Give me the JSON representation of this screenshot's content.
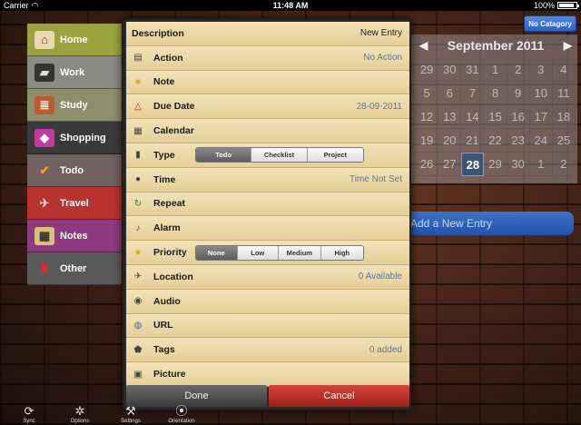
{
  "status_bar": {
    "carrier": "Carrier",
    "time": "11:48 AM",
    "battery": "100%"
  },
  "header": {
    "no_category_label": "No Catagory"
  },
  "calendar": {
    "month_year": "September 2011",
    "prev_arrow": "◀",
    "next_arrow": "▶",
    "days": [
      "29",
      "30",
      "31",
      "1",
      "2",
      "3",
      "4",
      "5",
      "6",
      "7",
      "8",
      "9",
      "10",
      "11",
      "12",
      "13",
      "14",
      "15",
      "16",
      "17",
      "18",
      "19",
      "20",
      "21",
      "22",
      "23",
      "24",
      "25",
      "26",
      "27",
      "28",
      "29",
      "30",
      "1",
      "2"
    ],
    "today": "28"
  },
  "add_entry": {
    "label": "Add a New Entry"
  },
  "categories": [
    {
      "label": "Home",
      "icon": "house-icon",
      "glyph": "⌂",
      "color": "#9aa33d",
      "icon_bg": "#e9d8b0"
    },
    {
      "label": "Work",
      "icon": "briefcase-icon",
      "glyph": "▰",
      "color": "#8a8a85",
      "icon_bg": "#333"
    },
    {
      "label": "Study",
      "icon": "books-icon",
      "glyph": "≣",
      "color": "#8d8e6c",
      "icon_bg": "#c05a2a"
    },
    {
      "label": "Shopping",
      "icon": "shopping-bag-icon",
      "glyph": "◆",
      "color": "#3a3a3a",
      "icon_bg": "#c03aa0"
    },
    {
      "label": "Todo",
      "icon": "checkmark-icon",
      "glyph": "✔",
      "color": "#6f6260",
      "icon_bg": "transparent"
    },
    {
      "label": "Travel",
      "icon": "airplane-icon",
      "glyph": "✈",
      "color": "#b8332e",
      "icon_bg": "transparent"
    },
    {
      "label": "Notes",
      "icon": "map-icon",
      "glyph": "▦",
      "color": "#8d3a7e",
      "icon_bg": "#d9c079"
    },
    {
      "label": "Other",
      "icon": "fries-icon",
      "glyph": "♜",
      "color": "#5a5a5a",
      "icon_bg": "transparent"
    }
  ],
  "form": {
    "description": {
      "label": "Description",
      "value": "New Entry"
    },
    "action": {
      "label": "Action",
      "value": "No Action"
    },
    "note": {
      "label": "Note"
    },
    "due_date": {
      "label": "Due Date",
      "value": "28-09-2011"
    },
    "calendar": {
      "label": "Calendar"
    },
    "type": {
      "label": "Type",
      "options": [
        "Todo",
        "Checklist",
        "Project"
      ],
      "selected": "Todo"
    },
    "time": {
      "label": "Time",
      "value": "Time Not Set"
    },
    "repeat": {
      "label": "Repeat"
    },
    "alarm": {
      "label": "Alarm"
    },
    "priority": {
      "label": "Priority",
      "options": [
        "None",
        "Low",
        "Medium",
        "High"
      ],
      "selected": "None"
    },
    "location": {
      "label": "Location",
      "value": "0 Available"
    },
    "audio": {
      "label": "Audio"
    },
    "url": {
      "label": "URL"
    },
    "tags": {
      "label": "Tags",
      "value": "0 added"
    },
    "picture": {
      "label": "Picture"
    },
    "done_label": "Done",
    "cancel_label": "Cancel"
  },
  "toolbar": {
    "sync": "Sync",
    "options": "Options",
    "settings": "Settings",
    "orientation": "Orientation"
  }
}
